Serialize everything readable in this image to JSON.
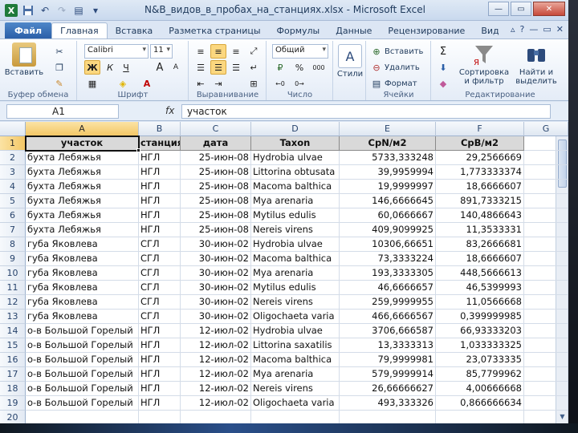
{
  "window": {
    "title": "N&B_видов_в_пробах_на_станциях.xlsx - Microsoft Excel",
    "excel_logo": "X"
  },
  "tabs": [
    {
      "label": "Файл",
      "kind": "file"
    },
    {
      "label": "Главная",
      "kind": "active"
    },
    {
      "label": "Вставка",
      "kind": ""
    },
    {
      "label": "Разметка страницы",
      "kind": ""
    },
    {
      "label": "Формулы",
      "kind": ""
    },
    {
      "label": "Данные",
      "kind": ""
    },
    {
      "label": "Рецензирование",
      "kind": ""
    },
    {
      "label": "Вид",
      "kind": ""
    }
  ],
  "ribbon": {
    "paste_label": "Вставить",
    "clipboard_label": "Буфер обмена",
    "font_name": "Calibri",
    "font_size": "11",
    "bold": "Ж",
    "italic": "К",
    "underline": "Ч",
    "font_grow": "A",
    "font_shrink": "A",
    "font_color_letter": "A",
    "font_label": "Шрифт",
    "align_label": "Выравнивание",
    "number_format": "Общий",
    "percent": "%",
    "thousands": "000",
    "number_label": "Число",
    "styles_label": "Стили",
    "insert_label": "Вставить",
    "delete_label": "Удалить",
    "format_label": "Формат",
    "cells_label": "Ячейки",
    "sigma": "Σ",
    "sort_label": "Сортировка и фильтр",
    "find_label": "Найти и выделить",
    "editing_label": "Редактирование"
  },
  "formula_bar": {
    "name_box": "A1",
    "fx": "fx",
    "value": "участок"
  },
  "columns": [
    "A",
    "B",
    "C",
    "D",
    "E",
    "F",
    "G"
  ],
  "sheet": {
    "header": [
      "участок",
      "станция",
      "дата",
      "Taxon",
      "CpN/м2",
      "CpB/м2"
    ],
    "rows": [
      [
        "бухта Лебяжья",
        "НГЛ",
        "25-июн-08",
        "Hydrobia ulvae",
        "5733,333248",
        "29,2566669"
      ],
      [
        "бухта Лебяжья",
        "НГЛ",
        "25-июн-08",
        "Littorina obtusata",
        "39,9959994",
        "1,773333374"
      ],
      [
        "бухта Лебяжья",
        "НГЛ",
        "25-июн-08",
        "Macoma balthica",
        "19,9999997",
        "18,6666607"
      ],
      [
        "бухта Лебяжья",
        "НГЛ",
        "25-июн-08",
        "Mya arenaria",
        "146,6666645",
        "891,7333215"
      ],
      [
        "бухта Лебяжья",
        "НГЛ",
        "25-июн-08",
        "Mytilus edulis",
        "60,0666667",
        "140,4866643"
      ],
      [
        "бухта Лебяжья",
        "НГЛ",
        "25-июн-08",
        "Nereis virens",
        "409,9099925",
        "11,3533331"
      ],
      [
        "губа Яковлева",
        "СГЛ",
        "30-июн-02",
        "Hydrobia ulvae",
        "10306,66651",
        "83,2666681"
      ],
      [
        "губа Яковлева",
        "СГЛ",
        "30-июн-02",
        "Macoma balthica",
        "73,3333224",
        "18,6666607"
      ],
      [
        "губа Яковлева",
        "СГЛ",
        "30-июн-02",
        "Mya arenaria",
        "193,3333305",
        "448,5666613"
      ],
      [
        "губа Яковлева",
        "СГЛ",
        "30-июн-02",
        "Mytilus edulis",
        "46,6666657",
        "46,5399993"
      ],
      [
        "губа Яковлева",
        "СГЛ",
        "30-июн-02",
        "Nereis virens",
        "259,9999955",
        "11,0566668"
      ],
      [
        "губа Яковлева",
        "СГЛ",
        "30-июн-02",
        "Oligochaeta varia",
        "466,6666567",
        "0,399999985"
      ],
      [
        "о-в Большой Горелый",
        "НГЛ",
        "12-июл-02",
        "Hydrobia ulvae",
        "3706,666587",
        "66,93333203"
      ],
      [
        "о-в Большой Горелый",
        "НГЛ",
        "12-июл-02",
        "Littorina saxatilis",
        "13,3333313",
        "1,033333325"
      ],
      [
        "о-в Большой Горелый",
        "НГЛ",
        "12-июл-02",
        "Macoma balthica",
        "79,9999981",
        "23,0733335"
      ],
      [
        "о-в Большой Горелый",
        "НГЛ",
        "12-июл-02",
        "Mya arenaria",
        "579,9999914",
        "85,7799962"
      ],
      [
        "о-в Большой Горелый",
        "НГЛ",
        "12-июл-02",
        "Nereis virens",
        "26,66666627",
        "4,00666668"
      ],
      [
        "о-в Большой Горелый",
        "НГЛ",
        "12-июл-02",
        "Oligochaeta varia",
        "493,333326",
        "0,866666634"
      ]
    ]
  },
  "colors": {
    "accent": "#2b579a",
    "selection": "#f3c766",
    "header_fill": "#d9d9d9"
  }
}
